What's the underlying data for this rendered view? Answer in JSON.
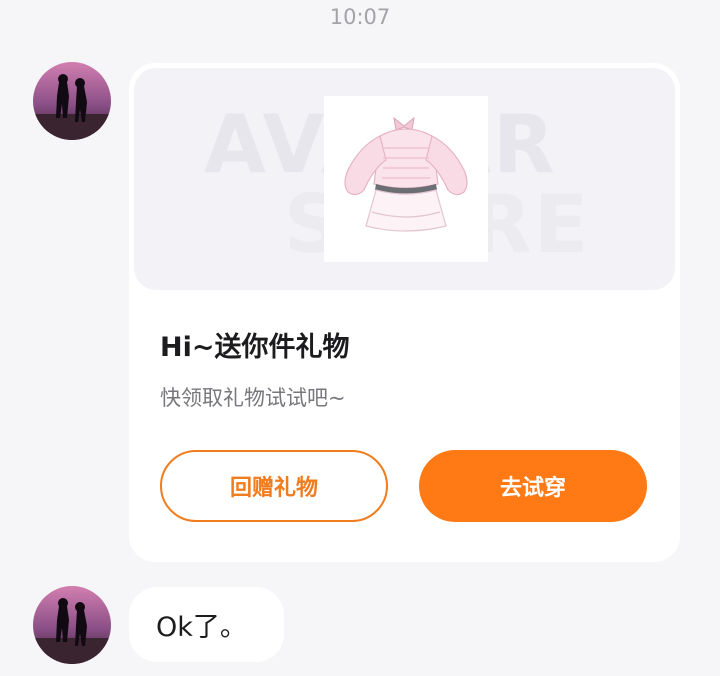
{
  "chat": {
    "timestamp": "10:07",
    "messages": [
      {
        "type": "gift_card",
        "banner_bg_text_line1": "AVATAR",
        "banner_bg_text_line2": "STORE",
        "product_image": "pink-top-and-skirt-outfit",
        "title": "Hi~送你件礼物",
        "subtitle": "快领取礼物试试吧~",
        "buttons": {
          "return_gift": "回赠礼物",
          "try_on": "去试穿"
        }
      },
      {
        "type": "text",
        "text": "Ok了。"
      }
    ]
  },
  "colors": {
    "accent": "#ff7a14",
    "background": "#f6f6f8",
    "card": "#ffffff"
  }
}
